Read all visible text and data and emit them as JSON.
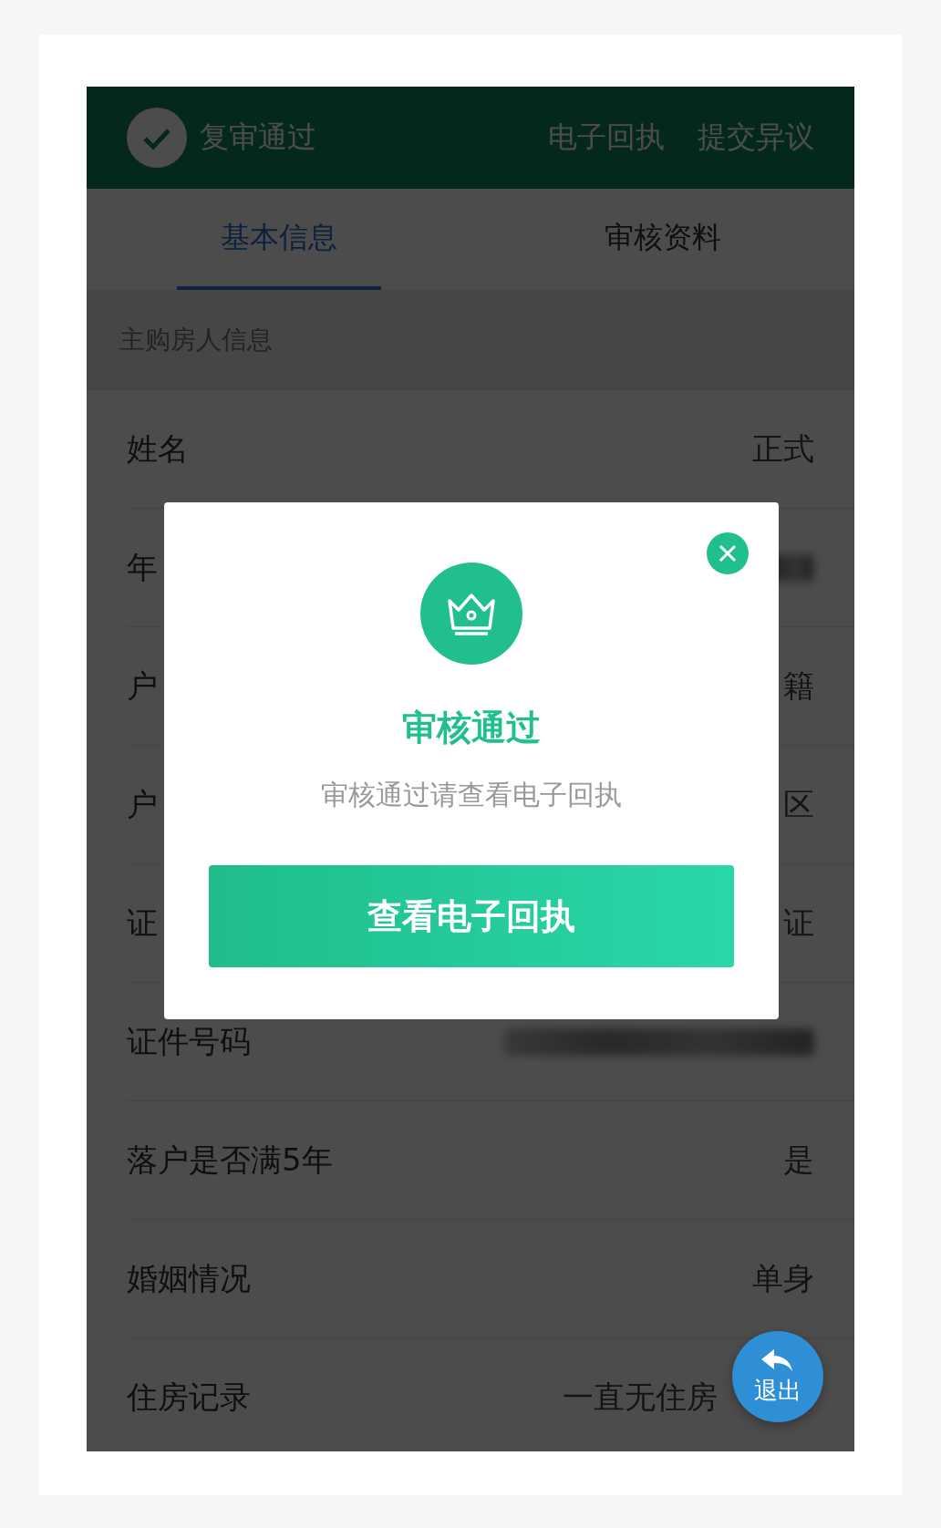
{
  "header": {
    "status": "复审通过",
    "links": [
      "电子回执",
      "提交异议"
    ]
  },
  "tabs": [
    {
      "label": "基本信息",
      "selected": true
    },
    {
      "label": "审核资料",
      "selected": false
    }
  ],
  "section_title": "主购房人信息",
  "rows": [
    {
      "label": "姓名",
      "value": "正式",
      "kind": "text"
    },
    {
      "label": "年",
      "kind": "redacted"
    },
    {
      "label": "户",
      "value": "籍",
      "kind": "text"
    },
    {
      "label": "户",
      "value": "区",
      "kind": "text"
    },
    {
      "label": "证",
      "value": "证",
      "kind": "text"
    },
    {
      "label": "证件号码",
      "kind": "redacted"
    },
    {
      "label": "落户是否满5年",
      "value": "是",
      "kind": "text"
    },
    {
      "label": "婚姻情况",
      "value": "单身",
      "kind": "text"
    },
    {
      "label": "住房记录",
      "value": "一直无住房",
      "kind": "text"
    }
  ],
  "exit_button": "退出",
  "dialog": {
    "title": "审核通过",
    "message": "审核通过请查看电子回执",
    "button": "查看电子回执"
  }
}
